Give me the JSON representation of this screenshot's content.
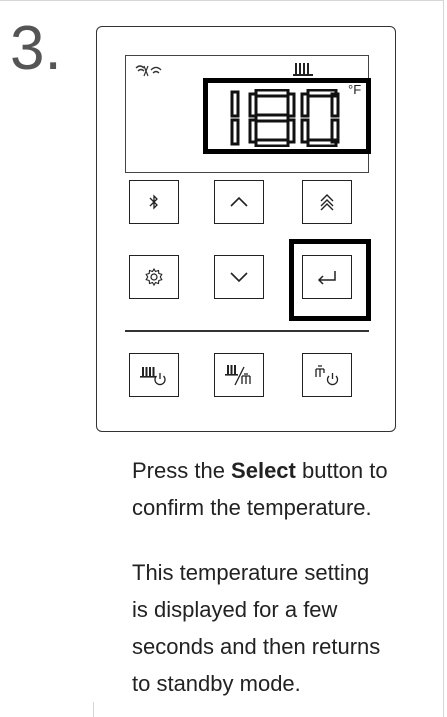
{
  "step": {
    "number": "3."
  },
  "display": {
    "temperature": "180",
    "unit": "°F",
    "icons": [
      "wifi-icon",
      "heating-icon"
    ]
  },
  "buttons": [
    {
      "name": "bluetooth-button",
      "icon": "bluetooth-icon"
    },
    {
      "name": "up-button",
      "icon": "chevron-up-icon"
    },
    {
      "name": "fast-up-button",
      "icon": "double-chevron-up-icon"
    },
    {
      "name": "settings-button",
      "icon": "gear-icon"
    },
    {
      "name": "down-button",
      "icon": "chevron-down-icon"
    },
    {
      "name": "select-button",
      "icon": "enter-icon"
    },
    {
      "name": "heating-power-button",
      "icon": "radiator-power-icon"
    },
    {
      "name": "heating-water-button",
      "icon": "radiator-tap-icon"
    },
    {
      "name": "water-power-button",
      "icon": "tap-power-icon"
    }
  ],
  "instructions": {
    "p1_before": "Press the ",
    "p1_bold": "Select",
    "p1_after_line1": " button to",
    "p1_line2": "confirm the temperature.",
    "p2_line1": "This temperature setting",
    "p2_line2": "is displayed for a few",
    "p2_line3": "seconds and then returns",
    "p2_line4": "to standby mode."
  },
  "colors": {
    "stroke": "#222222",
    "highlight": "#000000",
    "step_number": "#555555"
  }
}
